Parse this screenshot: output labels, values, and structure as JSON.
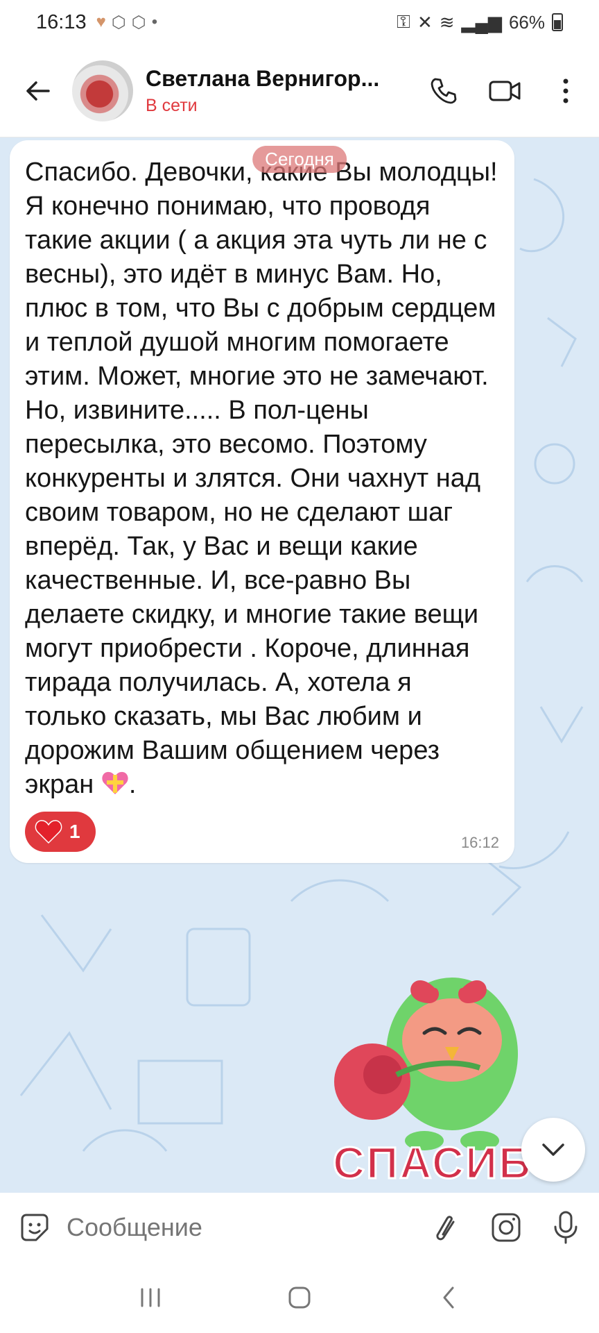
{
  "status_bar": {
    "time": "16:13",
    "battery": "66%"
  },
  "header": {
    "contact_name": "Светлана Вернигор...",
    "status": "В сети"
  },
  "chat": {
    "date_chip": "Сегодня",
    "message": {
      "text": "Спасибо. Девочки, какие Вы молодцы! Я конечно понимаю, что проводя такие акции ( а акция эта чуть ли не с весны), это идёт в минус Вам. Но, плюс в том, что Вы с добрым сердцем и теплой душой многим помогаете этим. Может, многие это не замечают. Но, извините..... В пол-цены пересылка, это весомо. Поэтому конкуренты и злятся. Они чахнут над своим товаром, но не сделают шаг вперёд. Так, у Вас и вещи какие качественные. И, все-равно Вы делаете скидку, и многие такие вещи могут приобрести . Короче, длинная тирада получилась. А, хотела я только сказать, мы Вас любим и дорожим Вашим общением через экран",
      "text_end": ".",
      "reaction_count": "1",
      "time": "16:12"
    },
    "sticker_text": "СПАСИБО"
  },
  "composer": {
    "placeholder": "Сообщение"
  },
  "colors": {
    "accent": "#e0393e",
    "chat_background": "#dbe9f6",
    "sticker_green": "#6fd36a",
    "sticker_red": "#e0475a"
  },
  "icons": [
    "back-arrow-icon",
    "phone-icon",
    "video-icon",
    "more-vert-icon",
    "sticker-icon",
    "attach-icon",
    "camera-icon",
    "mic-icon",
    "chevron-down-icon"
  ]
}
